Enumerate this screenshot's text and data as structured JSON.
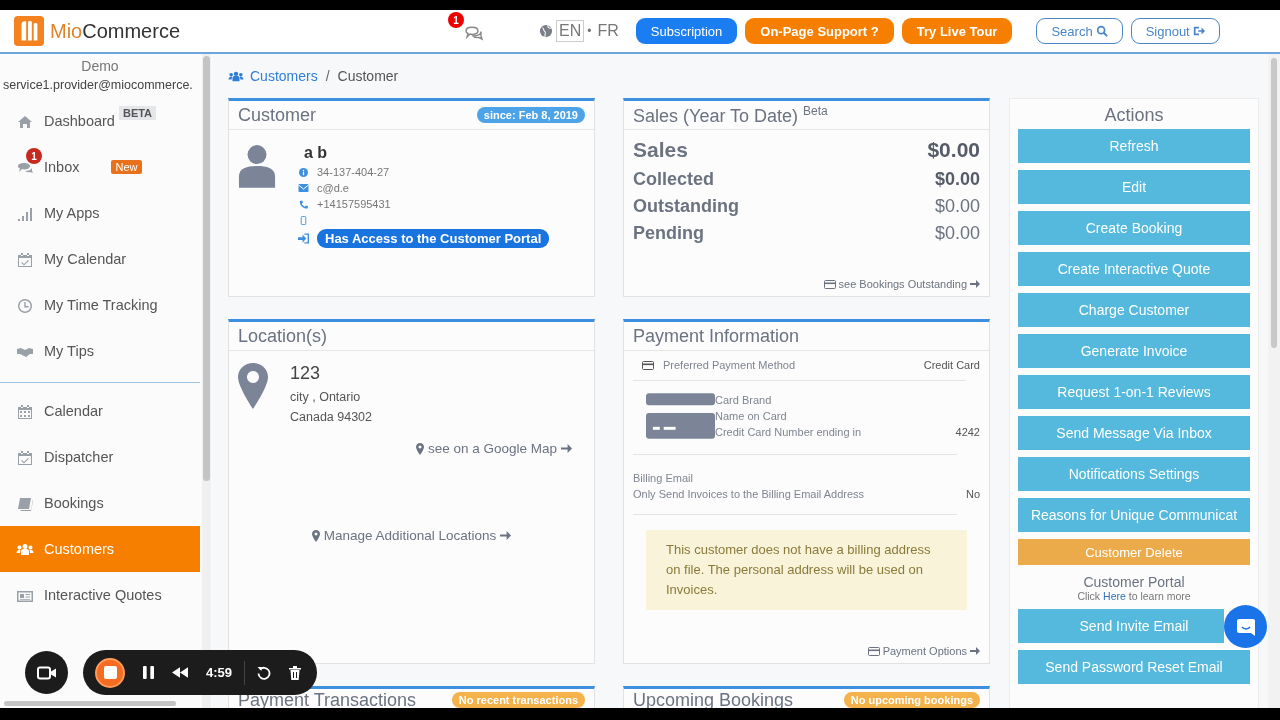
{
  "header": {
    "logo": {
      "brand": "Mio",
      "name": "Commerce"
    },
    "messages_count": "1",
    "languages": [
      {
        "label": "EN",
        "selected": true
      },
      {
        "label": "FR",
        "selected": false
      }
    ],
    "language_separator": "•",
    "buttons": [
      {
        "label": "Subscription",
        "kind": "primary"
      },
      {
        "label": "On-Page Support ?",
        "kind": "warning"
      },
      {
        "label": "Try Live Tour",
        "kind": "warning"
      },
      {
        "label": "Search",
        "kind": "outline"
      },
      {
        "label": "Signout",
        "kind": "outline"
      }
    ]
  },
  "sidebar": {
    "user_name": "Demo",
    "user_email": "service1.provider@miocommerce.",
    "groups": [
      [
        {
          "label": "Dashboard",
          "badge": {
            "text": "BETA",
            "kind": "beta"
          },
          "selected": false
        },
        {
          "label": "Inbox",
          "count": "1",
          "badge": {
            "text": "New",
            "kind": "new"
          },
          "selected": false
        },
        {
          "label": "My Apps",
          "selected": false
        },
        {
          "label": "My Calendar",
          "selected": false
        },
        {
          "label": "My Time Tracking",
          "selected": false
        },
        {
          "label": "My Tips",
          "selected": false
        }
      ],
      [
        {
          "label": "Calendar",
          "selected": false
        },
        {
          "label": "Dispatcher",
          "selected": false
        },
        {
          "label": "Bookings",
          "selected": false
        },
        {
          "label": "Customers",
          "selected": true
        },
        {
          "label": "Interactive Quotes",
          "selected": false
        }
      ]
    ]
  },
  "breadcrumb": [
    {
      "label": "Customers",
      "link": true
    },
    {
      "label": "Customer",
      "link": false
    }
  ],
  "breadcrumb_separator": "/",
  "customer": {
    "title": "Customer",
    "since": "since: Feb 8, 2019",
    "name": "a b",
    "id": "34-137-404-27",
    "email": "c@d.e",
    "phone": "+14157595431",
    "portal_access": "Has Access to the Customer Portal"
  },
  "sales": {
    "title": "Sales (Year To Date) $^{Beta}$",
    "rows": [
      {
        "label": "Sales",
        "value": "$0.00",
        "value_bold": true
      },
      {
        "label": "Collected",
        "value": "$0.00",
        "value_bold": true
      },
      {
        "label": "Outstanding",
        "value": "$0.00",
        "value_bold": false
      },
      {
        "label": "Pending",
        "value": "$0.00",
        "value_bold": false
      }
    ],
    "link": "see Bookings Outstanding"
  },
  "locations": {
    "title": "Location(s)",
    "address": [
      "123",
      "city , Ontario",
      "Canada 94302"
    ],
    "map_link": "see on a Google Map",
    "manage_link": "Manage Additional Locations"
  },
  "payment": {
    "title": "Payment Information",
    "preferred_label": "Preferred Payment Method",
    "preferred_value": "Credit Card",
    "card_rows": [
      {
        "label": "Card Brand"
      },
      {
        "label": "Name on Card"
      },
      {
        "label": "Credit Card Number ending in",
        "value": "4242"
      }
    ],
    "billing_email_label": "Billing Email",
    "only_send_label": "Only Send Invoices to the Billing Email Address",
    "only_send_value": "No",
    "notice": "This customer does not have a billing address on file. The personal address will be used on Invoices.",
    "options_link": "Payment Options"
  },
  "actions": {
    "title": "Actions",
    "buttons": [
      {
        "label": "Refresh",
        "kind": "action"
      },
      {
        "label": "Edit",
        "kind": "action"
      },
      {
        "label": "Create Booking",
        "kind": "action"
      },
      {
        "label": "Create Interactive Quote",
        "kind": "action"
      },
      {
        "label": "Charge Customer",
        "kind": "action"
      },
      {
        "label": "Generate Invoice",
        "kind": "action"
      },
      {
        "label": "Request 1-on-1 Reviews",
        "kind": "action"
      },
      {
        "label": "Send Message Via Inbox",
        "kind": "action"
      },
      {
        "label": "Notifications Settings",
        "kind": "action"
      },
      {
        "label": "Reasons for Unique Communicat",
        "kind": "action"
      },
      {
        "label": "Customer Delete",
        "kind": "danger"
      }
    ],
    "portal_title": "Customer Portal",
    "portal_hint_before": "Click",
    "portal_hint_link": "Here",
    "portal_hint_after": "to learn more",
    "portal_buttons": [
      {
        "label": "Send Invite Email",
        "kind": "action"
      },
      {
        "label": "Send Password Reset Email",
        "kind": "action"
      }
    ]
  },
  "bottom_cards": [
    {
      "title": "Payment Transactions",
      "badge": "No recent transactions"
    },
    {
      "title": "Upcoming Bookings",
      "badge": "No upcoming bookings"
    }
  ],
  "recorder": {
    "time": "4:59"
  }
}
